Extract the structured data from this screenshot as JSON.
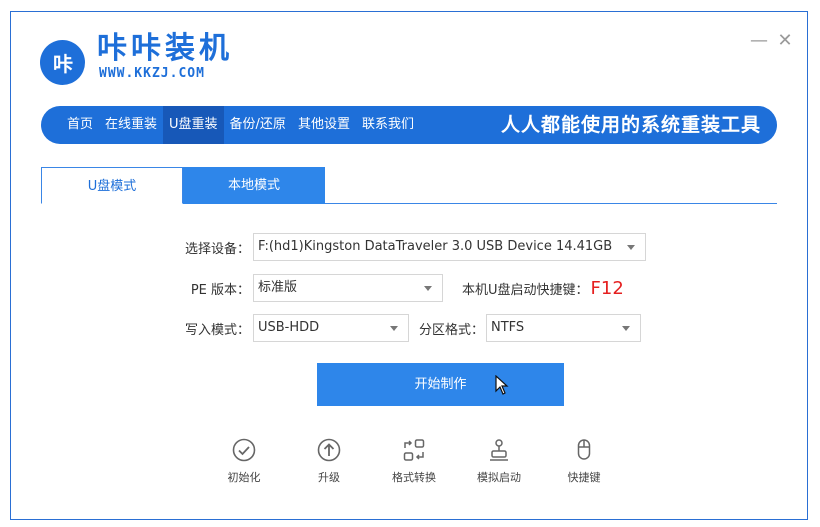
{
  "app": {
    "name": "咔咔装机",
    "url": "WWW.KKZJ.COM",
    "logo_text": "咔",
    "window_controls": {
      "minimize": "—",
      "close": "✕"
    }
  },
  "nav": {
    "items": [
      {
        "label": "首页"
      },
      {
        "label": "在线重装"
      },
      {
        "label": "U盘重装",
        "active": true
      },
      {
        "label": "备份/还原"
      },
      {
        "label": "其他设置"
      },
      {
        "label": "联系我们"
      }
    ],
    "slogan": "人人都能使用的系统重装工具"
  },
  "tabs": [
    {
      "label": "U盘模式",
      "active": true
    },
    {
      "label": "本地模式"
    }
  ],
  "form": {
    "device": {
      "label": "选择设备：",
      "value": "F:(hd1)Kingston DataTraveler 3.0 USB Device 14.41GB"
    },
    "pe_version": {
      "label": "PE 版本：",
      "value": "标准版"
    },
    "hotkey": {
      "label": "本机U盘启动快捷键：",
      "value": "F12"
    },
    "write_mode": {
      "label": "写入模式：",
      "value": "USB-HDD"
    },
    "partition": {
      "label": "分区格式：",
      "value": "NTFS"
    }
  },
  "start_button": "开始制作",
  "tools": [
    {
      "label": "初始化",
      "icon": "check-circle-icon"
    },
    {
      "label": "升级",
      "icon": "upgrade-arrow-icon"
    },
    {
      "label": "格式转换",
      "icon": "convert-icon"
    },
    {
      "label": "模拟启动",
      "icon": "simulate-boot-icon"
    },
    {
      "label": "快捷键",
      "icon": "mouse-icon"
    }
  ],
  "colors": {
    "accent": "#1e6fd9",
    "button": "#2e86ea",
    "hotkey": "#e52020"
  }
}
